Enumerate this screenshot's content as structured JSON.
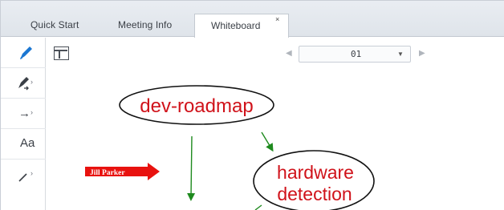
{
  "tabs": [
    {
      "label": "Quick Start",
      "active": false
    },
    {
      "label": "Meeting Info",
      "active": false
    },
    {
      "label": "Whiteboard",
      "active": true
    }
  ],
  "tab_close_glyph": "×",
  "toolbar": {
    "items": [
      {
        "icon": "pen-icon",
        "glyph": "✎",
        "active": true
      },
      {
        "icon": "highlighter-icon",
        "glyph": "✒",
        "has_menu": true
      },
      {
        "icon": "arrow-tool-icon",
        "glyph": "→",
        "has_menu": true
      },
      {
        "icon": "text-tool-icon",
        "glyph": "Aa"
      },
      {
        "icon": "line-tool-icon",
        "glyph": "╱",
        "has_menu": true
      }
    ],
    "chevron": "›"
  },
  "page_nav": {
    "prev": "◀",
    "next": "▶",
    "current_page": "01",
    "caret": "▼"
  },
  "whiteboard": {
    "node_1": "dev-roadmap",
    "node_2_line_1": "hardware",
    "node_2_line_2": "detection",
    "pointer_label": "Jill Parker"
  },
  "colors": {
    "accent": "#1b77d2",
    "node_text": "#d0121a",
    "arrow": "#1e8a1e",
    "pointer": "#e8120f"
  }
}
